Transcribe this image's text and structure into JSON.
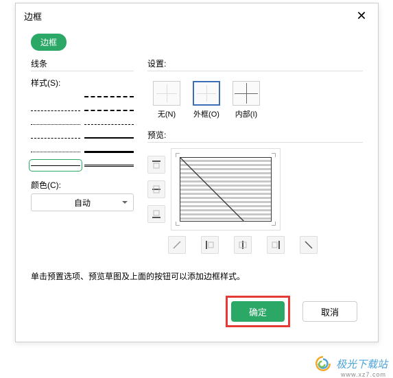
{
  "dialog": {
    "title": "边框",
    "tab": "边框"
  },
  "line": {
    "group_label": "线条",
    "style_label": "样式(S):",
    "color_label": "颜色(C):",
    "color_value": "自动"
  },
  "settings": {
    "group_label": "设置:",
    "presets": {
      "none": "无(N)",
      "outer": "外框(O)",
      "inner": "内部(I)"
    }
  },
  "preview": {
    "label": "预览:"
  },
  "hint": "单击预置选项、预览草图及上面的按钮可以添加边框样式。",
  "buttons": {
    "ok": "确定",
    "cancel": "取消"
  },
  "watermark": {
    "text": "极光下载站",
    "url": "www.xz7.com"
  }
}
